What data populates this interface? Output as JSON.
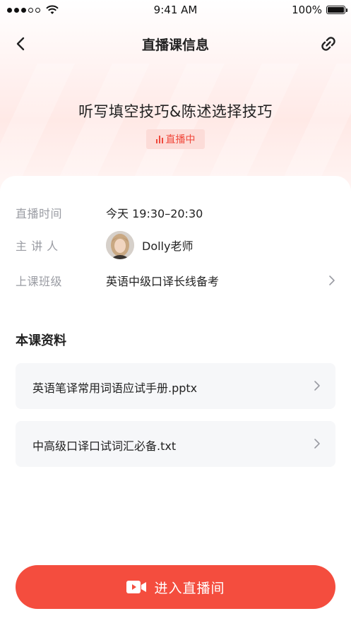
{
  "status_bar": {
    "time": "9:41 AM",
    "battery": "100%",
    "battery_level": 1.0,
    "signal_bars_filled": 3,
    "signal_bars_total": 5
  },
  "nav": {
    "title": "直播课信息",
    "back_icon": "chevron-left-icon",
    "share_icon": "link-icon"
  },
  "course": {
    "title": "听写填空技巧&陈述选择技巧",
    "status_badge": "直播中"
  },
  "info": {
    "time_label": "直播时间",
    "time_value": "今天 19:30–20:30",
    "speaker_label": "主 讲 人",
    "speaker_value": "Dolly老师",
    "class_label": "上课班级",
    "class_value": "英语中级口译长线备考"
  },
  "materials": {
    "title": "本课资料",
    "files": [
      {
        "name": "英语笔译常用词语应试手册.pptx"
      },
      {
        "name": "中高级口译口试词汇必备.txt"
      }
    ]
  },
  "actions": {
    "enter_label": "进入直播间"
  },
  "colors": {
    "accent": "#f44d3e",
    "badge_bg": "#fcdcd8",
    "muted_text": "#9a9ca3"
  }
}
